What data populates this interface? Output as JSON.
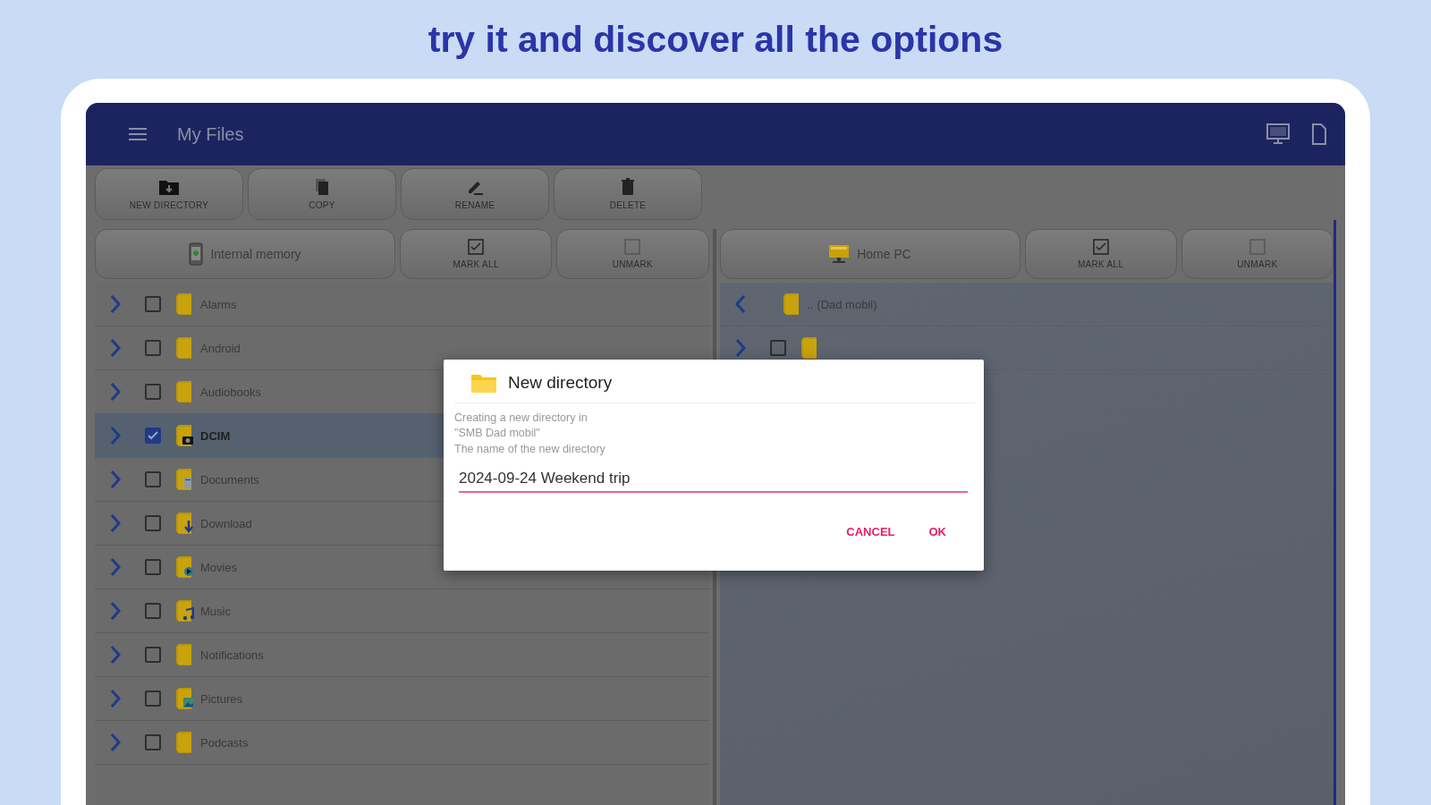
{
  "headline": "try it and discover all the options",
  "app_bar": {
    "title": "My Files"
  },
  "toolbar": [
    {
      "label": "NEW DIRECTORY",
      "kind": "new-folder"
    },
    {
      "label": "COPY",
      "kind": "copy"
    },
    {
      "label": "RENAME",
      "kind": "rename"
    },
    {
      "label": "DELETE",
      "kind": "delete"
    }
  ],
  "left_panel": {
    "location": {
      "label": "Internal memory",
      "kind": "phone"
    },
    "actions": [
      {
        "label": "MARK ALL",
        "kind": "mark"
      },
      {
        "label": "UNMARK",
        "kind": "unmark"
      }
    ],
    "rows": [
      {
        "name": "Alarms",
        "kind": "plain",
        "checked": false
      },
      {
        "name": "Android",
        "kind": "plain",
        "checked": false
      },
      {
        "name": "Audiobooks",
        "kind": "plain",
        "checked": false
      },
      {
        "name": "DCIM",
        "kind": "camera",
        "checked": true
      },
      {
        "name": "Documents",
        "kind": "document",
        "checked": false
      },
      {
        "name": "Download",
        "kind": "download",
        "checked": false
      },
      {
        "name": "Movies",
        "kind": "movie",
        "checked": false
      },
      {
        "name": "Music",
        "kind": "music",
        "checked": false
      },
      {
        "name": "Notifications",
        "kind": "plain",
        "checked": false
      },
      {
        "name": "Pictures",
        "kind": "picture",
        "checked": false
      },
      {
        "name": "Podcasts",
        "kind": "plain",
        "checked": false
      }
    ]
  },
  "right_panel": {
    "location": {
      "label": "Home PC",
      "kind": "network"
    },
    "actions": [
      {
        "label": "MARK ALL",
        "kind": "mark"
      },
      {
        "label": "UNMARK",
        "kind": "unmark"
      }
    ],
    "rows": [
      {
        "name": ".. (Dad mobil)",
        "kind": "parent"
      },
      {
        "kind": "plain",
        "checked": false
      }
    ]
  },
  "dialog": {
    "title": "New directory",
    "message": [
      "Creating a new directory in",
      "\"SMB Dad mobil\""
    ],
    "field_label": "The name of the new directory",
    "value": "2024-09-24 Weekend trip",
    "buttons": [
      "CANCEL",
      "OK"
    ]
  }
}
